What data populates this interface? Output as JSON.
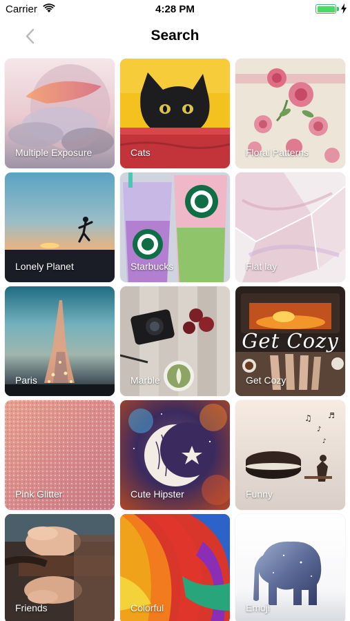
{
  "status_bar": {
    "carrier": "Carrier",
    "time": "4:28 PM",
    "battery_level": 1.0,
    "charging": true,
    "battery_color": "#4cd964"
  },
  "nav": {
    "title": "Search",
    "back_icon": "chevron-left-icon"
  },
  "categories": [
    {
      "label": "Multiple Exposure"
    },
    {
      "label": "Cats"
    },
    {
      "label": "Floral Patterns"
    },
    {
      "label": "Lonely Planet"
    },
    {
      "label": "Starbucks"
    },
    {
      "label": "Flat lay"
    },
    {
      "label": "Paris"
    },
    {
      "label": "Marble"
    },
    {
      "label": "Get Cozy",
      "overlay_text": "Get Cozy"
    },
    {
      "label": "Pink Glitter"
    },
    {
      "label": "Cute Hipster"
    },
    {
      "label": "Funny"
    },
    {
      "label": "Friends"
    },
    {
      "label": "Colorful"
    },
    {
      "label": "Emoji"
    }
  ]
}
